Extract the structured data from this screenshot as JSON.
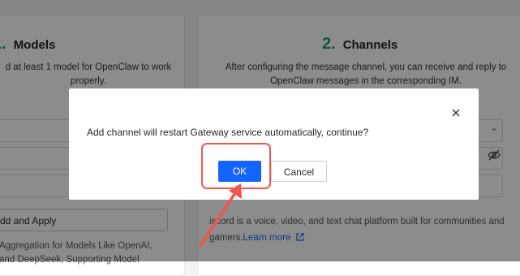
{
  "models_card": {
    "step_num": "1.",
    "title": "Models",
    "desc_line1": "d at least 1 model for OpenClaw to work",
    "desc_line2": "properly.",
    "add_button": "dd and Apply",
    "foot_line1": "Aggregation for Models Like OpenAI,",
    "foot_line2": "and DeepSeek, Supporting Model"
  },
  "channels_card": {
    "step_num": "2.",
    "title": "Channels",
    "desc_line1": "After configuring the message channel, you can receive and reply to",
    "desc_line2": "OpenClaw messages in the corresponding IM.",
    "foot_line1": "iscord is a voice, video, and text chat platform built for communities and",
    "foot_line2": "gamers.",
    "learn_more": "Learn more"
  },
  "dialog": {
    "message": "Add channel will restart Gateway service automatically, continue?",
    "ok_label": "OK",
    "cancel_label": "Cancel"
  },
  "colors": {
    "accent": "#1664ff",
    "highlight": "#f0564b",
    "step": "#1e9e6a"
  },
  "icons": {
    "close": "close-icon",
    "eye": "eye-hidden-icon",
    "chevron": "chevron-down-icon",
    "external": "external-link-icon"
  }
}
